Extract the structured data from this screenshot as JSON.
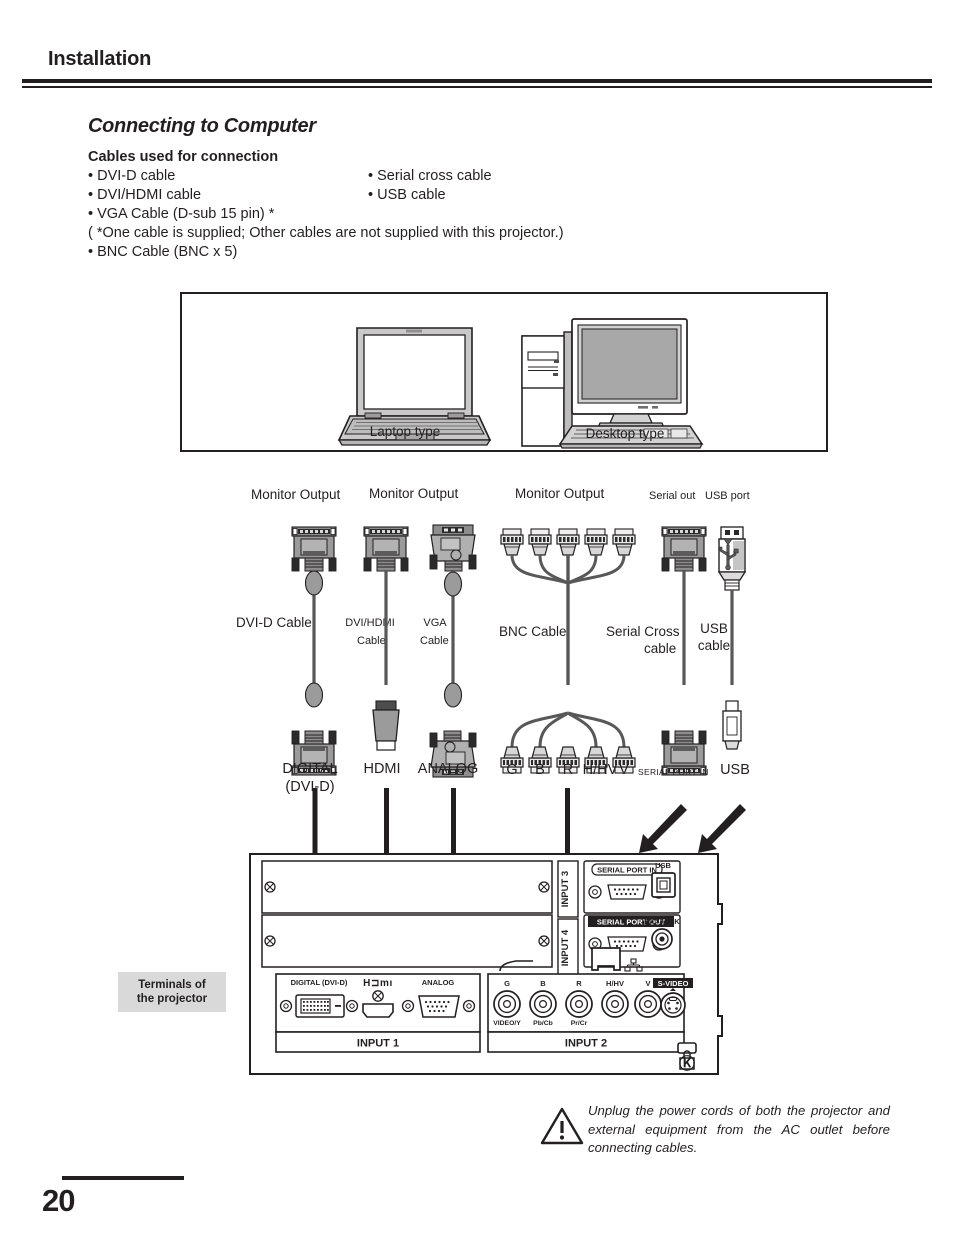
{
  "header": {
    "title": "Installation"
  },
  "section": {
    "title": "Connecting to Computer",
    "cables_heading": "Cables used for connection",
    "cables_left": [
      "• DVI-D cable",
      "• DVI/HDMI cable",
      "• VGA Cable (D-sub 15 pin)  *",
      "( *One cable is supplied; Other cables are not supplied with this projector.)",
      "• BNC Cable (BNC x 5)"
    ],
    "cables_right": [
      "• Serial cross cable",
      "• USB cable"
    ]
  },
  "computer_box": {
    "laptop_caption": "Laptop type",
    "desktop_caption": "Desktop type"
  },
  "diagram": {
    "source_labels": [
      {
        "text": "Monitor Output",
        "id": "monitor-output-dvi"
      },
      {
        "text": "Monitor Output",
        "id": "monitor-output-dvi-hdmi"
      },
      {
        "text": "Monitor Output",
        "id": "monitor-output-bnc"
      },
      {
        "text": "Serial out",
        "id": "serial-out"
      },
      {
        "text": "USB port",
        "id": "usb-port"
      }
    ],
    "monitor_output_1": "Monitor Output",
    "monitor_output_2": "Monitor Output",
    "monitor_output_3": "Monitor Output",
    "serial_out": "Serial out",
    "usb_port": "USB port",
    "cable_names": {
      "dvi_d": "DVI-D Cable",
      "dvi_hdmi_line1": "DVI/HDMI",
      "dvi_hdmi_line2": "Cable",
      "vga_line1": "VGA",
      "vga_line2": "Cable",
      "bnc": "BNC Cable",
      "serial_line1": "Serial Cross",
      "serial_line2": "cable",
      "usb_line1": "USB",
      "usb_line2": "cable"
    },
    "terminal_names": {
      "digital_line1": "DIGITAL",
      "digital_line2": "(DVI-D)",
      "hdmi": "HDMI",
      "analog": "ANALOG",
      "bnc_g": "G",
      "bnc_b": "B",
      "bnc_r": "R",
      "bnc_hhv": "H/HV",
      "bnc_v": "V",
      "serial_port_in": "SERIAL PORT IN",
      "usb": "USB"
    }
  },
  "projector_panel": {
    "callout": "Terminals of\nthe projector",
    "callout_line1": "Terminals of",
    "callout_line2": "the projector",
    "input1": {
      "group_label": "INPUT 1",
      "digital_label": "DIGITAL (DVI-D)",
      "hdmi_label": "HDMI",
      "analog_label": "ANALOG"
    },
    "input2": {
      "group_label": "INPUT 2",
      "bnc_top": [
        "G",
        "B",
        "R",
        "H/HV",
        "V"
      ],
      "bnc_bottom": [
        "VIDEO/Y",
        "Pb/Cb",
        "Pr/Cr"
      ],
      "svideo_label": "S-VIDEO"
    },
    "input3_label": "INPUT 3",
    "input4_label": "INPUT 4",
    "serial_port_in": "SERIAL PORT IN",
    "serial_port_out": "SERIAL PORT OUT",
    "usb_label": "USB",
    "rc_jack_label": "R/C JACK"
  },
  "caution": {
    "text": "Unplug the power cords of both the projector and external equipment from the AC outlet before connecting cables."
  },
  "footer": {
    "page_number": "20"
  },
  "colors": {
    "ink": "#231f20",
    "connector_body": "#9b9b9b",
    "connector_light": "#c0c0c0",
    "connector_dark": "#4d4d4d",
    "cable": "#585858",
    "callout_bg": "#d9d9d9",
    "screen_fill": "#a8a8a8"
  }
}
